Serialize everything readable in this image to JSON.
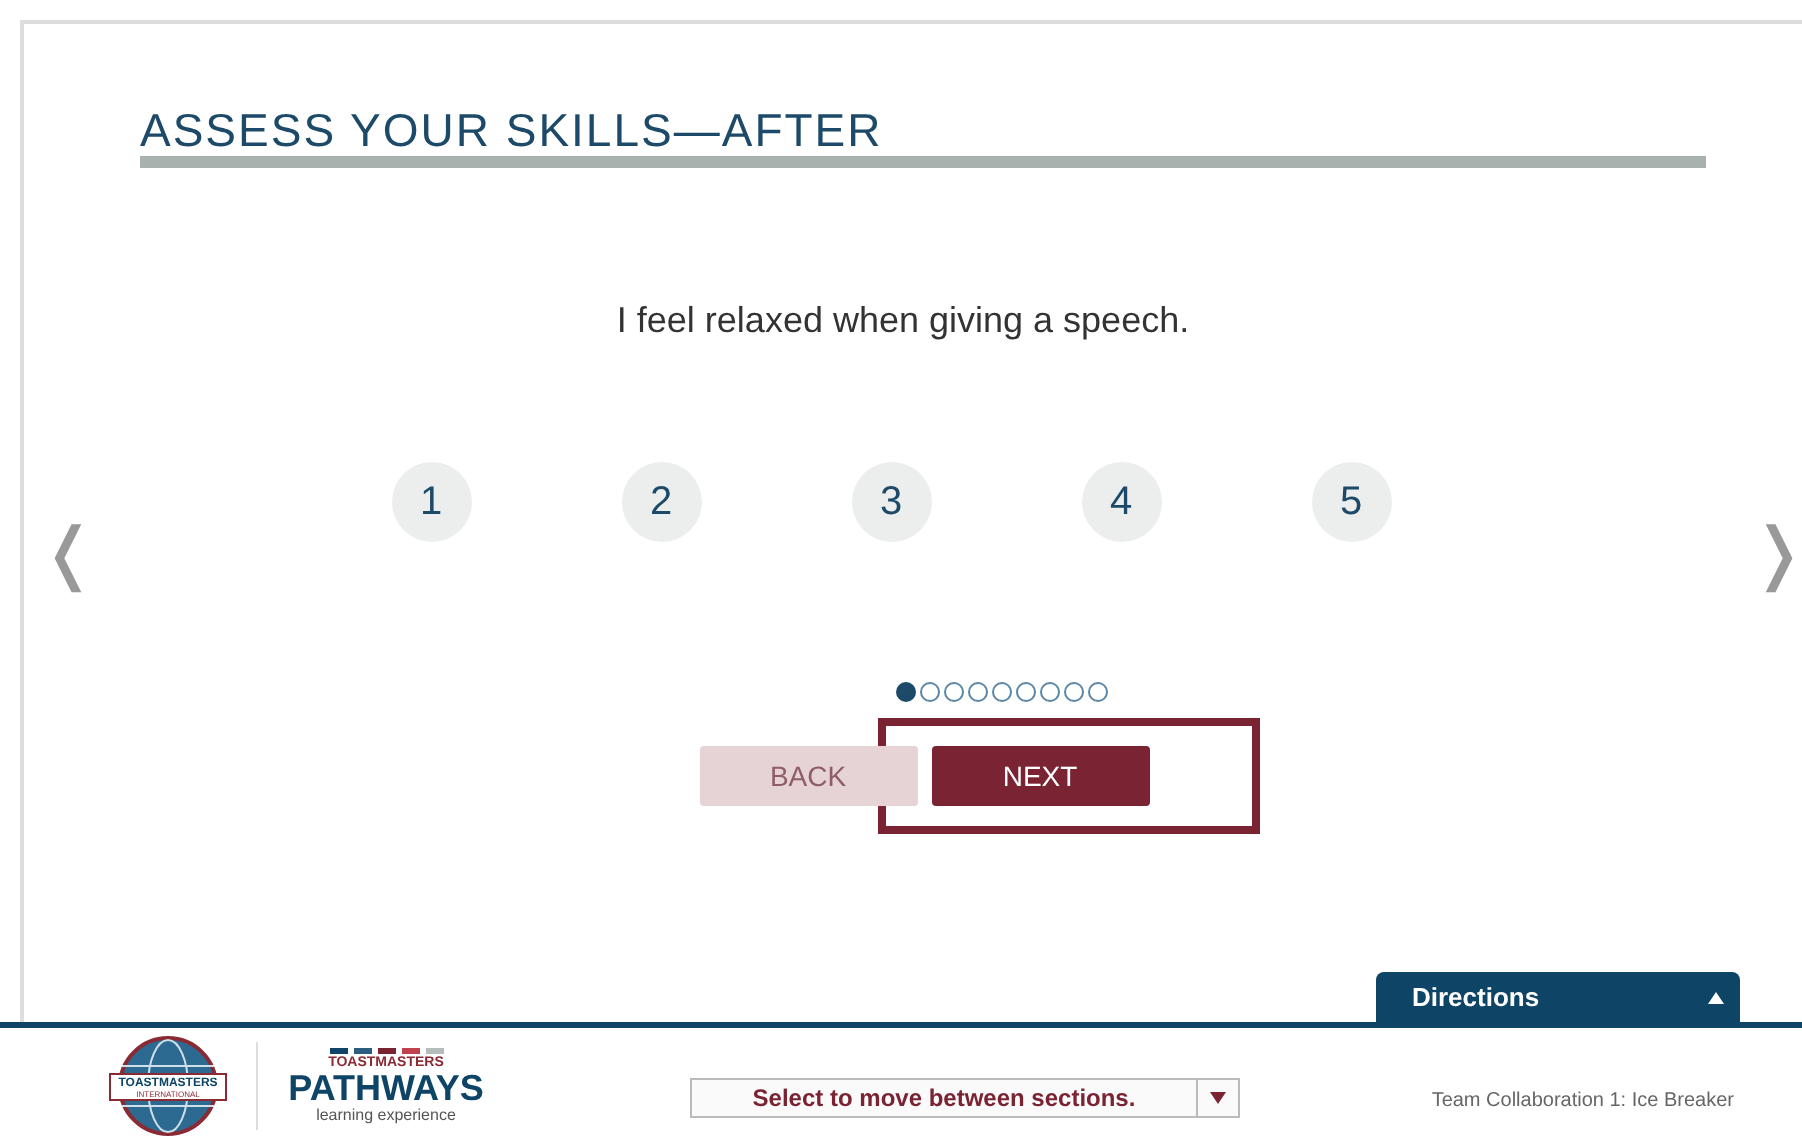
{
  "heading": "ASSESS YOUR SKILLS—AFTER",
  "question": "I feel relaxed when giving a speech.",
  "ratings": [
    {
      "label": "1",
      "selected": false
    },
    {
      "label": "2",
      "selected": false
    },
    {
      "label": "3",
      "selected": false
    },
    {
      "label": "4",
      "selected": false
    },
    {
      "label": "5",
      "selected": false
    }
  ],
  "nav": {
    "prev": "❬",
    "next": "❭"
  },
  "pager": [
    {
      "selected": true
    },
    {
      "selected": false
    },
    {
      "selected": false
    },
    {
      "selected": false
    },
    {
      "selected": false
    },
    {
      "selected": false
    },
    {
      "selected": false
    },
    {
      "selected": false
    },
    {
      "selected": false
    }
  ],
  "buttons": [
    {
      "label": "BACK",
      "disabled": true,
      "highlighted": false
    },
    {
      "label": "NEXT",
      "disabled": false,
      "highlighted": true
    }
  ],
  "directions": {
    "label": "Directions",
    "expanded": false
  },
  "footer": {
    "logo_top": "TOASTMASTERS",
    "logo_bottom": "INTERNATIONAL",
    "pathways_top": "TOASTMASTERS",
    "pathways": "PATHWAYS",
    "pathways_sub": "learning experience",
    "section_select": "Select to move between sections.",
    "course": "Team Collaboration 1: Ice Breaker"
  }
}
